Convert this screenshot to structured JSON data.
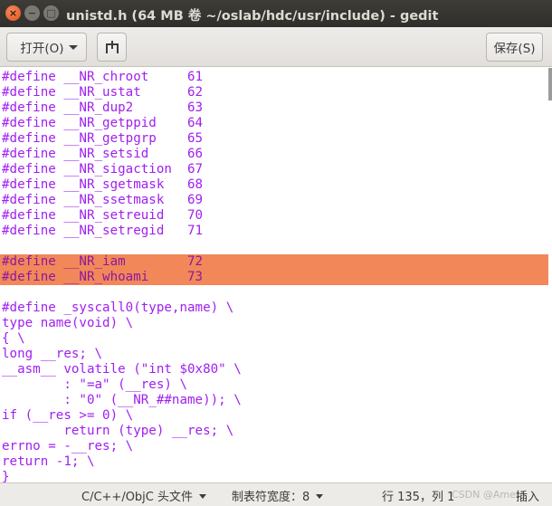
{
  "window": {
    "title": "unistd.h (64 MB 卷 ~/oslab/hdc/usr/include) - gedit",
    "close_glyph": "×",
    "minimize_glyph": "−",
    "maximize_glyph": "□"
  },
  "toolbar": {
    "open_label": "打开(O)",
    "new_tab_icon": "new-tab-icon",
    "save_label": "保存(S)"
  },
  "editor": {
    "text_color": "#a020f0",
    "selection_color": "#f2875a",
    "lines": [
      "#define __NR_chroot     61",
      "#define __NR_ustat      62",
      "#define __NR_dup2       63",
      "#define __NR_getppid    64",
      "#define __NR_getpgrp    65",
      "#define __NR_setsid     66",
      "#define __NR_sigaction  67",
      "#define __NR_sgetmask   68",
      "#define __NR_ssetmask   69",
      "#define __NR_setreuid   70",
      "#define __NR_setregid   71",
      "",
      "#define __NR_iam        72",
      "#define __NR_whoami     73",
      "",
      "#define _syscall0(type,name) \\",
      "type name(void) \\",
      "{ \\",
      "long __res; \\",
      "__asm__ volatile (\"int $0x80\" \\",
      "        : \"=a\" (__res) \\",
      "        : \"0\" (__NR_##name)); \\",
      "if (__res >= 0) \\",
      "        return (type) __res; \\",
      "errno = -__res; \\",
      "return -1; \\",
      "}"
    ]
  },
  "statusbar": {
    "language": "C/C++/ObjC 头文件",
    "tab_width": "制表符宽度：8",
    "position": "行 135，列 1",
    "mode": "插入",
    "watermark": "CSDN @Ameto"
  }
}
